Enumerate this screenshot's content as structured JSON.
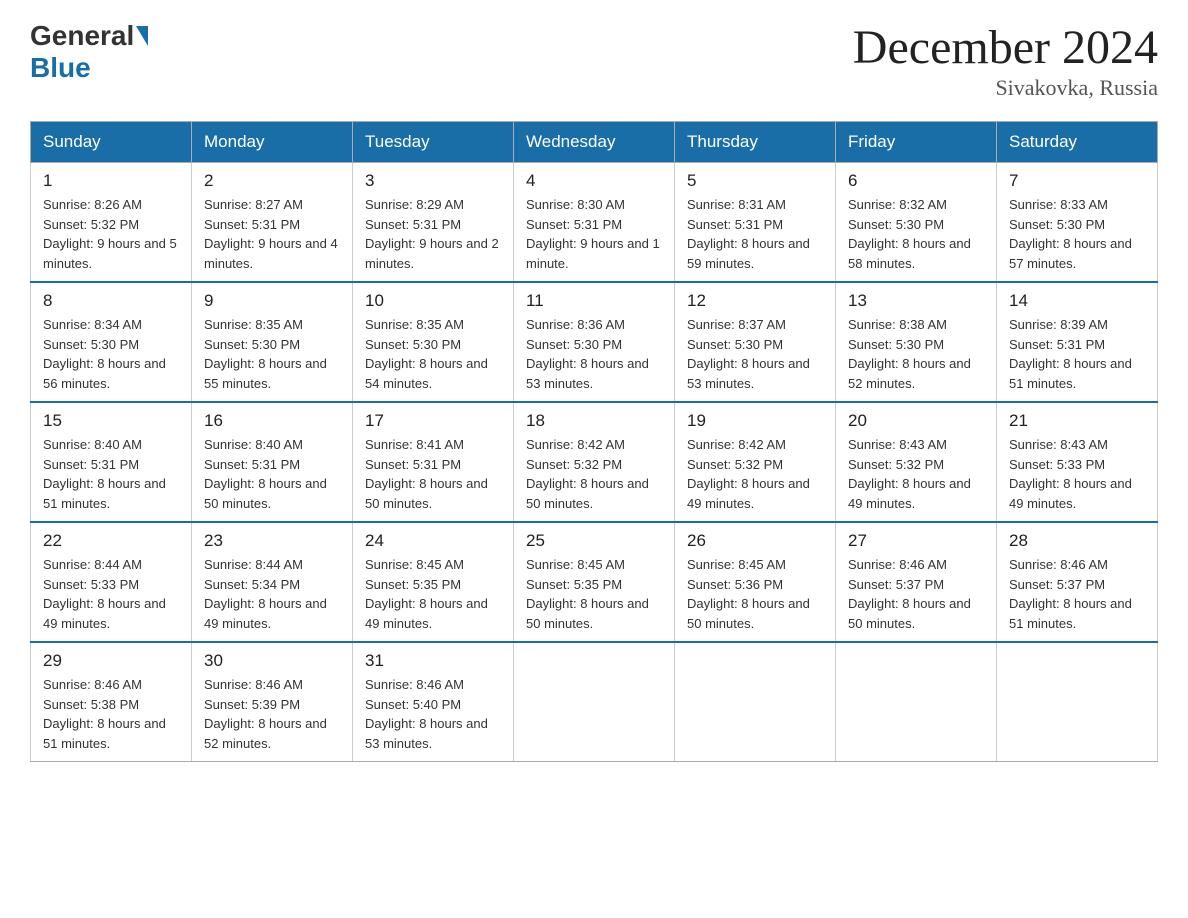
{
  "header": {
    "logo": {
      "general": "General",
      "blue": "Blue"
    },
    "title": "December 2024",
    "location": "Sivakovka, Russia"
  },
  "weekdays": [
    "Sunday",
    "Monday",
    "Tuesday",
    "Wednesday",
    "Thursday",
    "Friday",
    "Saturday"
  ],
  "weeks": [
    [
      {
        "day": "1",
        "sunrise": "8:26 AM",
        "sunset": "5:32 PM",
        "daylight": "9 hours and 5 minutes."
      },
      {
        "day": "2",
        "sunrise": "8:27 AM",
        "sunset": "5:31 PM",
        "daylight": "9 hours and 4 minutes."
      },
      {
        "day": "3",
        "sunrise": "8:29 AM",
        "sunset": "5:31 PM",
        "daylight": "9 hours and 2 minutes."
      },
      {
        "day": "4",
        "sunrise": "8:30 AM",
        "sunset": "5:31 PM",
        "daylight": "9 hours and 1 minute."
      },
      {
        "day": "5",
        "sunrise": "8:31 AM",
        "sunset": "5:31 PM",
        "daylight": "8 hours and 59 minutes."
      },
      {
        "day": "6",
        "sunrise": "8:32 AM",
        "sunset": "5:30 PM",
        "daylight": "8 hours and 58 minutes."
      },
      {
        "day": "7",
        "sunrise": "8:33 AM",
        "sunset": "5:30 PM",
        "daylight": "8 hours and 57 minutes."
      }
    ],
    [
      {
        "day": "8",
        "sunrise": "8:34 AM",
        "sunset": "5:30 PM",
        "daylight": "8 hours and 56 minutes."
      },
      {
        "day": "9",
        "sunrise": "8:35 AM",
        "sunset": "5:30 PM",
        "daylight": "8 hours and 55 minutes."
      },
      {
        "day": "10",
        "sunrise": "8:35 AM",
        "sunset": "5:30 PM",
        "daylight": "8 hours and 54 minutes."
      },
      {
        "day": "11",
        "sunrise": "8:36 AM",
        "sunset": "5:30 PM",
        "daylight": "8 hours and 53 minutes."
      },
      {
        "day": "12",
        "sunrise": "8:37 AM",
        "sunset": "5:30 PM",
        "daylight": "8 hours and 53 minutes."
      },
      {
        "day": "13",
        "sunrise": "8:38 AM",
        "sunset": "5:30 PM",
        "daylight": "8 hours and 52 minutes."
      },
      {
        "day": "14",
        "sunrise": "8:39 AM",
        "sunset": "5:31 PM",
        "daylight": "8 hours and 51 minutes."
      }
    ],
    [
      {
        "day": "15",
        "sunrise": "8:40 AM",
        "sunset": "5:31 PM",
        "daylight": "8 hours and 51 minutes."
      },
      {
        "day": "16",
        "sunrise": "8:40 AM",
        "sunset": "5:31 PM",
        "daylight": "8 hours and 50 minutes."
      },
      {
        "day": "17",
        "sunrise": "8:41 AM",
        "sunset": "5:31 PM",
        "daylight": "8 hours and 50 minutes."
      },
      {
        "day": "18",
        "sunrise": "8:42 AM",
        "sunset": "5:32 PM",
        "daylight": "8 hours and 50 minutes."
      },
      {
        "day": "19",
        "sunrise": "8:42 AM",
        "sunset": "5:32 PM",
        "daylight": "8 hours and 49 minutes."
      },
      {
        "day": "20",
        "sunrise": "8:43 AM",
        "sunset": "5:32 PM",
        "daylight": "8 hours and 49 minutes."
      },
      {
        "day": "21",
        "sunrise": "8:43 AM",
        "sunset": "5:33 PM",
        "daylight": "8 hours and 49 minutes."
      }
    ],
    [
      {
        "day": "22",
        "sunrise": "8:44 AM",
        "sunset": "5:33 PM",
        "daylight": "8 hours and 49 minutes."
      },
      {
        "day": "23",
        "sunrise": "8:44 AM",
        "sunset": "5:34 PM",
        "daylight": "8 hours and 49 minutes."
      },
      {
        "day": "24",
        "sunrise": "8:45 AM",
        "sunset": "5:35 PM",
        "daylight": "8 hours and 49 minutes."
      },
      {
        "day": "25",
        "sunrise": "8:45 AM",
        "sunset": "5:35 PM",
        "daylight": "8 hours and 50 minutes."
      },
      {
        "day": "26",
        "sunrise": "8:45 AM",
        "sunset": "5:36 PM",
        "daylight": "8 hours and 50 minutes."
      },
      {
        "day": "27",
        "sunrise": "8:46 AM",
        "sunset": "5:37 PM",
        "daylight": "8 hours and 50 minutes."
      },
      {
        "day": "28",
        "sunrise": "8:46 AM",
        "sunset": "5:37 PM",
        "daylight": "8 hours and 51 minutes."
      }
    ],
    [
      {
        "day": "29",
        "sunrise": "8:46 AM",
        "sunset": "5:38 PM",
        "daylight": "8 hours and 51 minutes."
      },
      {
        "day": "30",
        "sunrise": "8:46 AM",
        "sunset": "5:39 PM",
        "daylight": "8 hours and 52 minutes."
      },
      {
        "day": "31",
        "sunrise": "8:46 AM",
        "sunset": "5:40 PM",
        "daylight": "8 hours and 53 minutes."
      },
      null,
      null,
      null,
      null
    ]
  ],
  "labels": {
    "sunrise": "Sunrise:",
    "sunset": "Sunset:",
    "daylight": "Daylight:"
  }
}
